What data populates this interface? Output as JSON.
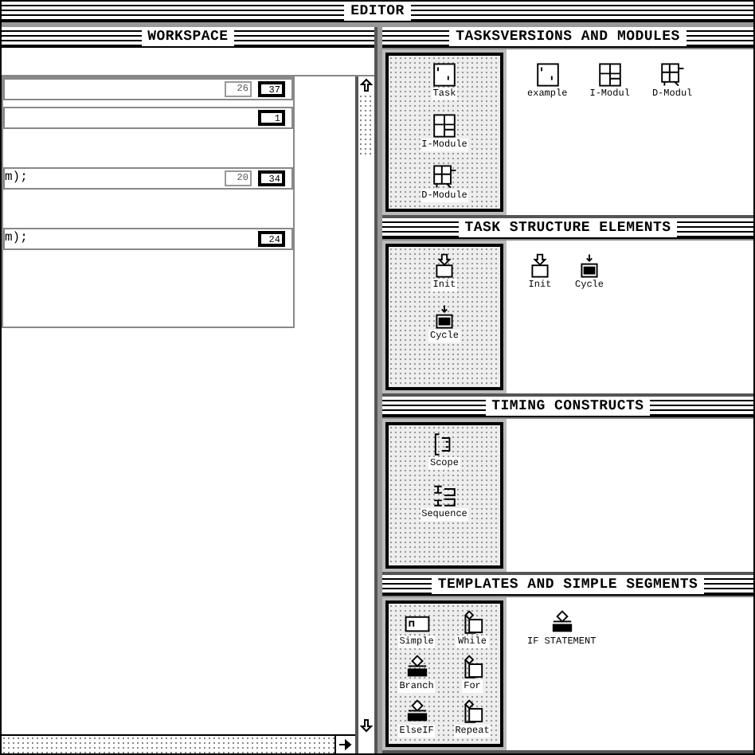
{
  "window": {
    "title": "EDITOR"
  },
  "workspace": {
    "title": "WORKSPACE",
    "code_rows": [
      {
        "numbers": [
          {
            "text": "26",
            "kind": "plain"
          },
          {
            "text": "37",
            "kind": "framed"
          }
        ]
      },
      {
        "numbers": [
          {
            "text": "1",
            "kind": "framed"
          }
        ]
      },
      {
        "text": "m);",
        "numbers": [
          {
            "text": "20",
            "kind": "plain"
          },
          {
            "text": "34",
            "kind": "framed"
          }
        ]
      },
      {
        "text": "m);",
        "numbers": [
          {
            "text": "24",
            "kind": "framed"
          }
        ]
      }
    ]
  },
  "sections": [
    {
      "title": "TASKSVERSIONS AND MODULES",
      "palette": [
        {
          "label": "Task",
          "kind": "task"
        },
        {
          "label": "I-Module",
          "kind": "imodule"
        },
        {
          "label": "D-Module",
          "kind": "dmodule"
        }
      ],
      "items": [
        {
          "label": "example",
          "kind": "task"
        },
        {
          "label": "I-Modul",
          "kind": "imodule"
        },
        {
          "label": "D-Modul",
          "kind": "dmodule"
        }
      ]
    },
    {
      "title": "TASK STRUCTURE ELEMENTS",
      "palette": [
        {
          "label": "Init",
          "kind": "init"
        },
        {
          "label": "Cycle",
          "kind": "cycle"
        }
      ],
      "items": [
        {
          "label": "Init",
          "kind": "init"
        },
        {
          "label": "Cycle",
          "kind": "cycle"
        }
      ]
    },
    {
      "title": "TIMING CONSTRUCTS",
      "palette": [
        {
          "label": "Scope",
          "kind": "scope"
        },
        {
          "label": "Sequence",
          "kind": "sequence"
        }
      ]
    },
    {
      "title": "TEMPLATES AND SIMPLE SEGMENTS",
      "palette": [
        {
          "label": "Simple",
          "kind": "simple"
        },
        {
          "label": "While",
          "kind": "loop"
        },
        {
          "label": "Branch",
          "kind": "branch"
        },
        {
          "label": "For",
          "kind": "loop"
        },
        {
          "label": "ElseIF",
          "kind": "branch"
        },
        {
          "label": "Repeat",
          "kind": "loop"
        }
      ],
      "items": [
        {
          "label": "IF STATEMENT",
          "kind": "branch"
        }
      ]
    }
  ]
}
